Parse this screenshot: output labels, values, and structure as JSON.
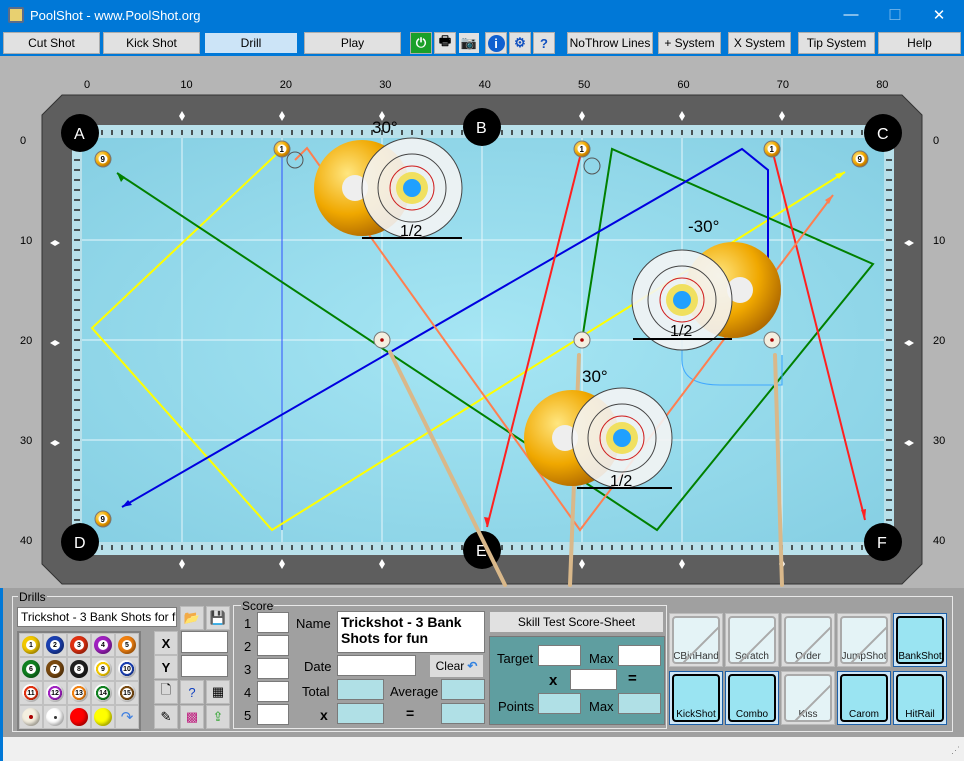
{
  "window": {
    "title": "PoolShot - www.PoolShot.org",
    "minimize": "—",
    "maximize": "☐",
    "close": "✕"
  },
  "toolbar": {
    "buttons": [
      "Cut Shot",
      "Kick Shot",
      "Drill",
      "Play"
    ],
    "selected": "Drill",
    "icons": [
      "power-icon",
      "print-icon",
      "camera-icon",
      "info-icon",
      "gear-icon",
      "help-doc-icon"
    ],
    "right_buttons": [
      "NoThrow Lines",
      "+ System",
      "X System",
      "Tip System",
      "Help"
    ]
  },
  "table": {
    "x_ticks": [
      "0",
      "10",
      "20",
      "30",
      "40",
      "50",
      "60",
      "70",
      "80"
    ],
    "y_ticks": [
      "0",
      "10",
      "20",
      "30",
      "40"
    ],
    "pockets": [
      "A",
      "B",
      "C",
      "D",
      "E",
      "F"
    ],
    "angle_labels": [
      "30°",
      "-30°",
      "30°"
    ],
    "fraction_labels": [
      "1/2",
      "1/2",
      "1/2"
    ],
    "ball_labels": {
      "nine": "9",
      "one": "1"
    },
    "line_colors": {
      "yellow": "#ffff00",
      "green": "#008000",
      "blue": "#0000e0",
      "red": "#ff2020",
      "orange": "#ff7f50"
    }
  },
  "drills": {
    "legend": "Drills",
    "drill_name": "Trickshot - 3 Bank  Shots for fun",
    "x_label": "X",
    "y_label": "Y",
    "x_value": "",
    "y_value": "",
    "balls": [
      {
        "n": "1",
        "c": "#f2c800"
      },
      {
        "n": "2",
        "c": "#1a3fb0"
      },
      {
        "n": "3",
        "c": "#e03010"
      },
      {
        "n": "4",
        "c": "#a020c0"
      },
      {
        "n": "5",
        "c": "#f08010"
      },
      {
        "n": "6",
        "c": "#108020"
      },
      {
        "n": "7",
        "c": "#7a4a10"
      },
      {
        "n": "8",
        "c": "#202020"
      },
      {
        "n": "9",
        "c": "#f2c800"
      },
      {
        "n": "10",
        "c": "#1a3fb0"
      },
      {
        "n": "11",
        "c": "#e03010"
      },
      {
        "n": "12",
        "c": "#a020c0"
      },
      {
        "n": "13",
        "c": "#f08010"
      },
      {
        "n": "14",
        "c": "#108020"
      },
      {
        "n": "15",
        "c": "#7a4a10"
      }
    ]
  },
  "score": {
    "legend": "Score",
    "rows": [
      "1",
      "2",
      "3",
      "4",
      "5"
    ],
    "name_label": "Name",
    "name_value": "Trickshot - 3 Bank Shots for fun",
    "date_label": "Date",
    "date_value": "",
    "clear_label": "Clear",
    "total_label": "Total",
    "average_label": "Average",
    "x_label": "x",
    "eq_label": "="
  },
  "skill": {
    "title": "Skill Test Score-Sheet",
    "target_label": "Target",
    "max_label": "Max",
    "x_label": "x",
    "eq_label": "=",
    "points_label": "Points",
    "max2_label": "Max"
  },
  "shot_types": [
    {
      "label": "CBinHand",
      "enabled": false
    },
    {
      "label": "Scratch",
      "enabled": false
    },
    {
      "label": "Order",
      "enabled": false
    },
    {
      "label": "JumpShot",
      "enabled": false
    },
    {
      "label": "BankShot",
      "enabled": true
    },
    {
      "label": "KickShot",
      "enabled": true
    },
    {
      "label": "Combo",
      "enabled": true
    },
    {
      "label": "Kiss",
      "enabled": false
    },
    {
      "label": "Carom",
      "enabled": true
    },
    {
      "label": "HitRail",
      "enabled": true
    }
  ]
}
